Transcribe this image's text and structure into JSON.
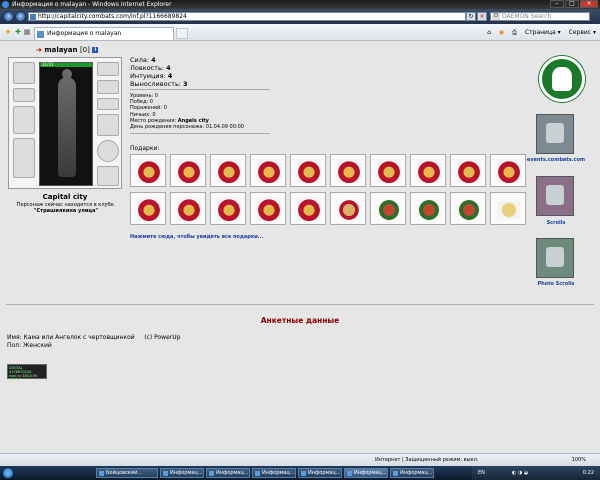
{
  "window": {
    "title": "Информация о malayan - Windows Internet Explorer"
  },
  "address": {
    "url": "http://capitalcity.combats.com/inf.pl?1166689824"
  },
  "search": {
    "placeholder": "DAEMON Search"
  },
  "tab": {
    "label": "Информация о malayan"
  },
  "tools": {
    "page": "Страница",
    "service": "Сервис"
  },
  "character": {
    "nick": "malayan",
    "level": "[0]",
    "hp": "31/31",
    "city": "Capital city",
    "club_note": "Персонаж сейчас находится в клубе.",
    "club_place": "\"Страшилкина улица\""
  },
  "stats": [
    {
      "label": "Сила:",
      "value": "4"
    },
    {
      "label": "Ловкость:",
      "value": "4"
    },
    {
      "label": "Интуиция:",
      "value": "4"
    },
    {
      "label": "Выносливость:",
      "value": "3"
    }
  ],
  "info": [
    {
      "label": "Уровень:",
      "value": "0"
    },
    {
      "label": "Побед:",
      "value": "0"
    },
    {
      "label": "Поражений:",
      "value": "0"
    },
    {
      "label": "Ничьих:",
      "value": "0"
    },
    {
      "label": "Место рождения:",
      "value": "Angels city"
    },
    {
      "label": "День рождения персонажа:",
      "value": "01.04.09 00:00"
    }
  ],
  "gifts": {
    "label": "Подарки:",
    "more_link": "Нажмите сюда, чтобы увидеть все подарки..."
  },
  "sidebar": {
    "events": "events.combats.com",
    "scrolls": "Scrolls",
    "photo_scrolls": "Photo Scrolls"
  },
  "anketa": {
    "title": "Анкетные данные",
    "name_line": "Имя: Кама или Ангелок с чертовщинкой     (c) PowerUp",
    "gender_line": "Пол: Женский"
  },
  "counter": {
    "line1": "DIGITAL 4176670244",
    "line2": "mail.ru 464,536",
    "line3": "50024"
  },
  "status": {
    "zone": "Интернет | Защищенный режим: выкл.",
    "zoom": "100%"
  },
  "taskbar": {
    "items": [
      "Бойцовский...",
      "Информац...",
      "Информац...",
      "Информац...",
      "Информац...",
      "Информац...",
      "Информац..."
    ],
    "lang": "EN",
    "time": "0:22"
  }
}
